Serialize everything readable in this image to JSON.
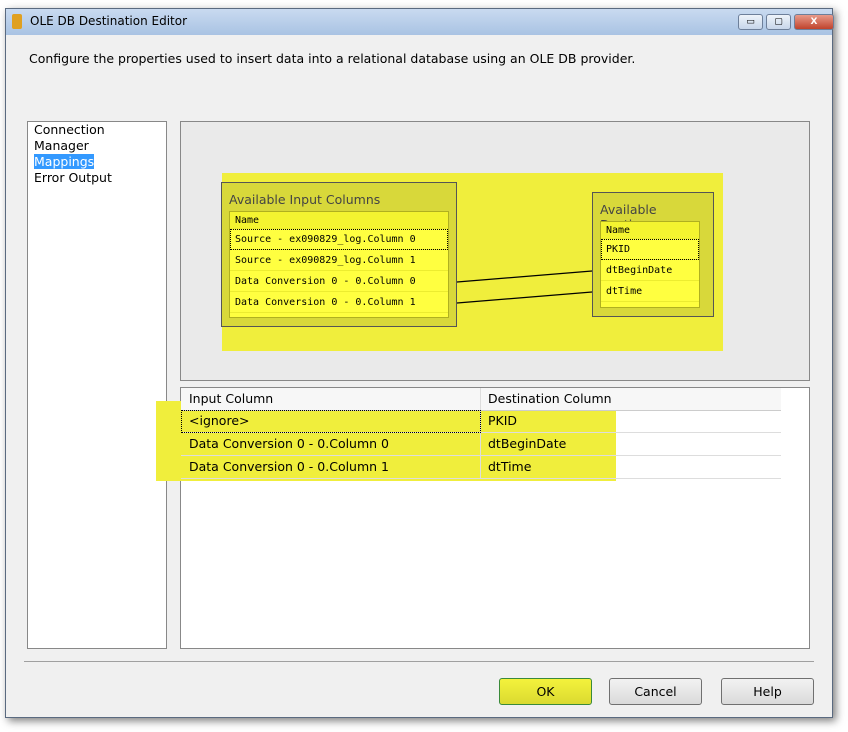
{
  "window": {
    "title": "OLE DB Destination Editor",
    "minimize": "▭",
    "maximize": "▢",
    "close": "X"
  },
  "description": "Configure the properties used to insert data into a relational database using an OLE DB provider.",
  "nav": {
    "items": [
      {
        "label": "Connection Manager"
      },
      {
        "label": "Mappings",
        "selected": true
      },
      {
        "label": "Error Output"
      }
    ]
  },
  "diagram": {
    "input": {
      "title": "Available Input Columns",
      "header": "Name",
      "rows": [
        "Source - ex090829_log.Column 0",
        "Source - ex090829_log.Column 1",
        "Data Conversion 0 - 0.Column 0",
        "Data Conversion 0 - 0.Column 1"
      ]
    },
    "dest": {
      "title": "Available Destin...",
      "header": "Name",
      "rows": [
        "PKID",
        "dtBeginDate",
        "dtTime"
      ]
    }
  },
  "grid": {
    "headers": [
      "Input Column",
      "Destination Column"
    ],
    "rows": [
      [
        "<ignore>",
        "PKID"
      ],
      [
        "Data Conversion 0 - 0.Column 0",
        "dtBeginDate"
      ],
      [
        "Data Conversion 0 - 0.Column 1",
        "dtTime"
      ]
    ]
  },
  "buttons": {
    "ok": "OK",
    "cancel": "Cancel",
    "help": "Help"
  },
  "highlight_color": "#f0ee3c"
}
